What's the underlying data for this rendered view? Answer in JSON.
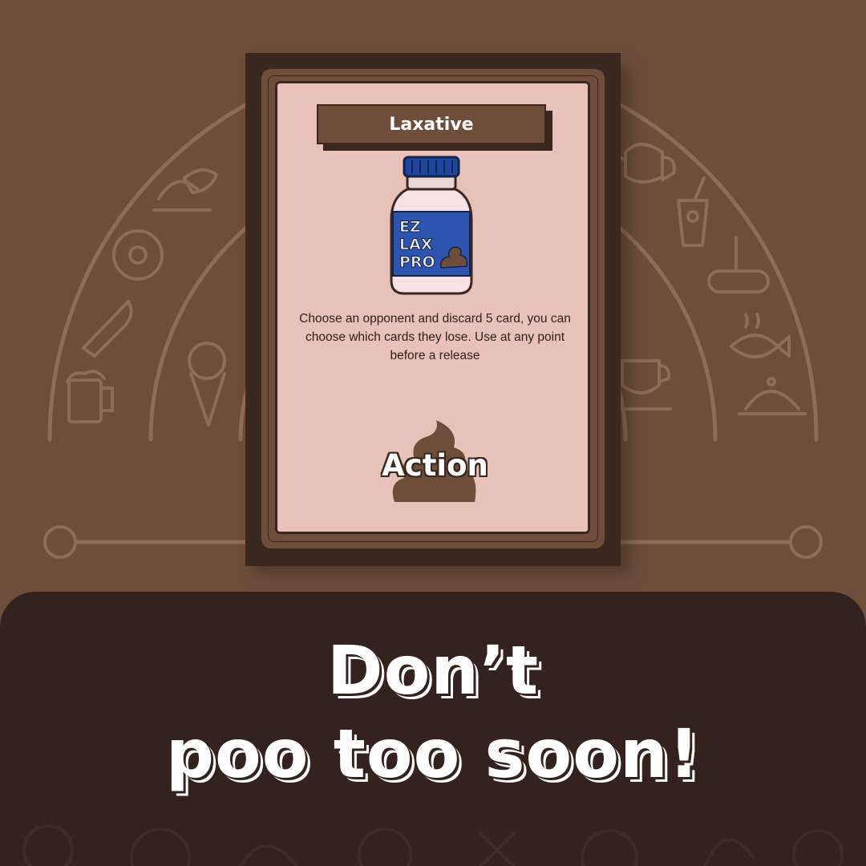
{
  "card": {
    "title": "Laxative",
    "bottle_label": [
      "EZ",
      "LAX",
      "PRO"
    ],
    "description": "Choose an opponent and discard 5 card, you can choose which cards they lose. Use at any point before a release",
    "type_label": "Action"
  },
  "headline": {
    "line1": "Don’t",
    "line2": "poo too soon!"
  },
  "colors": {
    "background": "#6e4e3b",
    "dark": "#33221d",
    "card_face": "#e8c2b8",
    "bottle_label": "#2d55b0",
    "bottle_cap": "#1f47a0"
  },
  "decor_icons": [
    "cloche-icon",
    "chicken-icon",
    "donut-icon",
    "knife-icon",
    "beer-mug-icon",
    "ice-cream-icon",
    "teapot-icon",
    "soda-cup-icon",
    "sausage-fork-icon",
    "fish-icon",
    "coffee-cup-icon",
    "serving-dish-icon"
  ]
}
